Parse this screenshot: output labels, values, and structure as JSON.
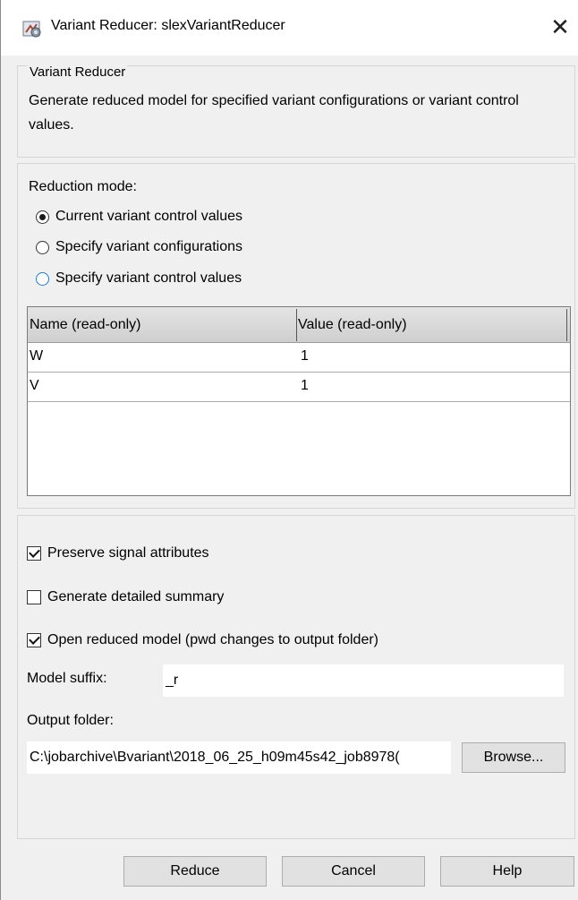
{
  "window": {
    "title": "Variant Reducer: slexVariantReducer",
    "close_glyph": "✕",
    "icon": "variant-reducer-app-icon"
  },
  "description_panel": {
    "legend": "Variant Reducer",
    "text": "Generate reduced model for specified variant configurations or variant control values."
  },
  "reduction": {
    "label": "Reduction mode:",
    "options": [
      {
        "label": "Current variant control values",
        "selected": true
      },
      {
        "label": "Specify variant configurations",
        "selected": false
      },
      {
        "label": "Specify variant control values",
        "selected": false
      }
    ],
    "table": {
      "columns": [
        "Name (read-only)",
        "Value (read-only)"
      ],
      "rows": [
        {
          "name": "W",
          "value": "1"
        },
        {
          "name": "V",
          "value": "1"
        }
      ]
    }
  },
  "options": {
    "preserve_signal": {
      "label": "Preserve signal attributes",
      "checked": true
    },
    "detailed_summary": {
      "label": "Generate detailed summary",
      "checked": false
    },
    "open_reduced": {
      "label": "Open reduced model (pwd changes to output folder)",
      "checked": true
    },
    "model_suffix": {
      "label": "Model suffix:",
      "value": "_r"
    },
    "output_folder": {
      "label": "Output folder:",
      "value": "C:\\jobarchive\\Bvariant\\2018_06_25_h09m45s42_job8978(",
      "browse_label": "Browse..."
    }
  },
  "footer": {
    "reduce_label": "Reduce",
    "cancel_label": "Cancel",
    "help_label": "Help"
  }
}
